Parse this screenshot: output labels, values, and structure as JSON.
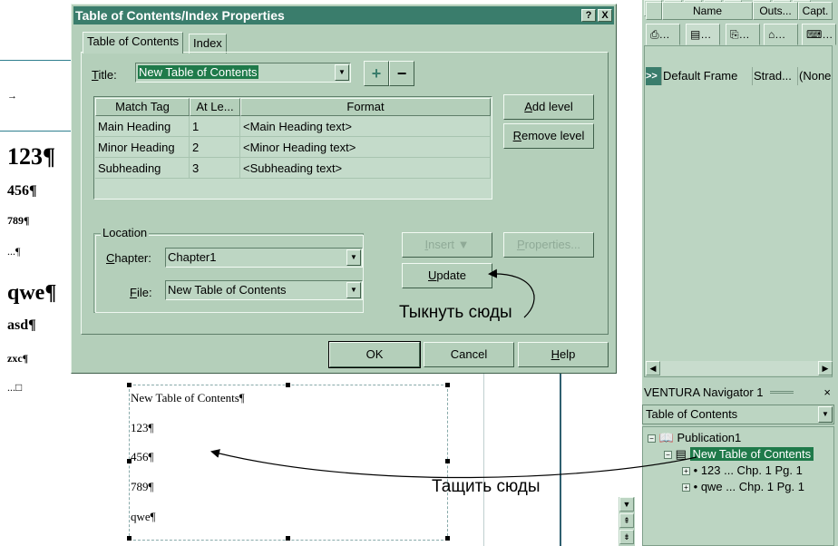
{
  "background_doc": {
    "lines": [
      "123¶",
      "456¶",
      "789¶",
      "...¶",
      "qwe¶",
      "asd¶",
      "zxc¶",
      "...□"
    ],
    "arrow_glyph": "→"
  },
  "page_frame": {
    "lines": [
      "New Table of Contents¶",
      "123¶",
      "456¶",
      "789¶",
      "qwe¶"
    ]
  },
  "dialog": {
    "title": "Table of Contents/Index Properties",
    "help_btn": "?",
    "close_btn": "X",
    "tabs": [
      {
        "label": "Table of Contents",
        "active": true
      },
      {
        "label": "Index",
        "active": false
      }
    ],
    "title_label": "Title:",
    "title_value": "New Table of Contents",
    "add_btn": "+",
    "remove_btn": "−",
    "table": {
      "headers": [
        "Match Tag",
        "At Le...",
        "Format"
      ],
      "rows": [
        [
          "Main Heading",
          "1",
          "<Main Heading text>"
        ],
        [
          "Minor Heading",
          "2",
          "<Minor Heading text>"
        ],
        [
          "Subheading",
          "3",
          "<Subheading text>"
        ]
      ]
    },
    "add_level": "Add level",
    "remove_level": "Remove level",
    "location": {
      "legend": "Location",
      "chapter_label": "Chapter:",
      "chapter_value": "Chapter1",
      "file_label": "File:",
      "file_value": "New Table of Contents"
    },
    "insert_btn": "Insert ▼",
    "properties_btn": "Properties...",
    "update_btn": "Update",
    "ok_btn": "OK",
    "cancel_btn": "Cancel",
    "help_text_btn": "Help"
  },
  "annotations": {
    "click_here": "Тыкнуть сюды",
    "drag_here": "Тащить сюды"
  },
  "right_panel": {
    "grid": {
      "headers": [
        "Name",
        "Outs...",
        "Capt."
      ],
      "row_marker": ">>",
      "row": [
        "Default Frame",
        "Strad...",
        "(None"
      ]
    },
    "navigator": {
      "title": "VENTURA Navigator 1",
      "close": "×",
      "select_value": "Table of Contents",
      "tree": [
        {
          "label": "Publication1",
          "level": 0
        },
        {
          "label": "New Table of Contents",
          "level": 1,
          "selected": true
        },
        {
          "label": "123 ... Chp. 1 Pg. 1",
          "level": 2
        },
        {
          "label": "qwe ... Chp. 1 Pg. 1",
          "level": 2
        }
      ]
    }
  }
}
